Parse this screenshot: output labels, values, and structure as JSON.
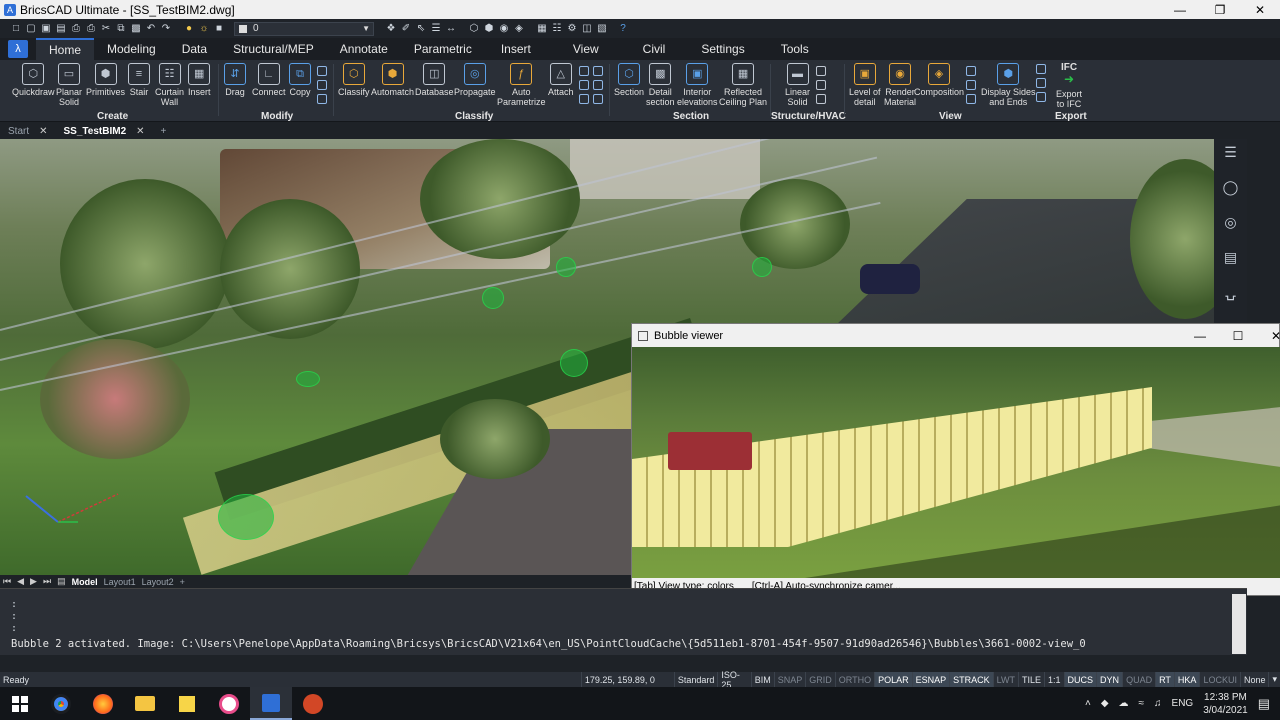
{
  "window": {
    "title": "BricsCAD Ultimate - [SS_TestBIM2.dwg]",
    "app_icon": "A"
  },
  "qat": {
    "layer_value": "0"
  },
  "ribbon_tabs": [
    "Home",
    "Modeling",
    "Data",
    "Structural/MEP",
    "Annotate",
    "Parametric",
    "Insert",
    "View",
    "Civil",
    "Settings",
    "Tools"
  ],
  "ribbon": {
    "buttons": [
      {
        "label": "Quickdraw",
        "icon": "quickdraw-icon"
      },
      {
        "label": "Planar\nSolid",
        "icon": "planar-solid-icon"
      },
      {
        "label": "Primitives",
        "icon": "primitives-icon"
      },
      {
        "label": "Stair",
        "icon": "stair-icon"
      },
      {
        "label": "Curtain\nWall",
        "icon": "curtain-wall-icon"
      },
      {
        "label": "Insert",
        "icon": "insert-icon"
      },
      {
        "label": "Drag",
        "icon": "drag-icon"
      },
      {
        "label": "Connect",
        "icon": "connect-icon"
      },
      {
        "label": "Copy",
        "icon": "copy-icon"
      },
      {
        "label": "Classify",
        "icon": "classify-icon"
      },
      {
        "label": "Automatch",
        "icon": "automatch-icon"
      },
      {
        "label": "Database",
        "icon": "database-icon"
      },
      {
        "label": "Propagate",
        "icon": "propagate-icon"
      },
      {
        "label": "Auto\nParametrize",
        "icon": "auto-parametrize-icon"
      },
      {
        "label": "Attach",
        "icon": "attach-icon"
      },
      {
        "label": "Section",
        "icon": "section-icon"
      },
      {
        "label": "Detail\nsection",
        "icon": "detail-section-icon"
      },
      {
        "label": "Interior\nelevations",
        "icon": "interior-elevations-icon"
      },
      {
        "label": "Reflected\nCeiling Plan",
        "icon": "reflected-ceiling-icon"
      },
      {
        "label": "Linear\nSolid",
        "icon": "linear-solid-icon"
      },
      {
        "label": "Level of\ndetail",
        "icon": "level-of-detail-icon"
      },
      {
        "label": "Render\nMaterial",
        "icon": "render-material-icon"
      },
      {
        "label": "Composition",
        "icon": "composition-icon"
      },
      {
        "label": "Display Sides\nand Ends",
        "icon": "display-sides-icon"
      },
      {
        "label": "Export\nto IFC",
        "icon": "export-ifc-icon"
      }
    ],
    "groups": [
      "Create",
      "Modify",
      "Classify",
      "Section",
      "Structure/HVAC",
      "View",
      "Export"
    ],
    "ifc_text": "IFC"
  },
  "doc_tabs": [
    {
      "label": "Start"
    },
    {
      "label": "SS_TestBIM2"
    }
  ],
  "doc_tab_add": "+",
  "bubble_viewer": {
    "title": "Bubble viewer",
    "status_left": "[Tab] View type: colors",
    "status_right": "[Ctrl-A] Auto-synchronize camer..."
  },
  "layout_tabs": [
    "Model",
    "Layout1",
    "Layout2"
  ],
  "layout_add": "+",
  "command": {
    "prompt_dots": [
      ":",
      ":",
      ":"
    ],
    "message": "Bubble 2 activated. Image: C:\\Users\\Penelope\\AppData\\Roaming\\Bricsys\\BricsCAD\\V21x64\\en_US\\PointCloudCache\\{5d511eb1-8701-454f-9507-91d90ad26546}\\Bubbles\\3661-0002-view_0"
  },
  "status": {
    "ready": "Ready",
    "coords": "179.25, 159.89, 0",
    "items": [
      {
        "label": "Standard",
        "state": "on"
      },
      {
        "label": "ISO-25",
        "state": "on"
      },
      {
        "label": "BIM",
        "state": "on"
      },
      {
        "label": "SNAP",
        "state": "off"
      },
      {
        "label": "GRID",
        "state": "off"
      },
      {
        "label": "ORTHO",
        "state": "off"
      },
      {
        "label": "POLAR",
        "state": "on"
      },
      {
        "label": "ESNAP",
        "state": "on"
      },
      {
        "label": "STRACK",
        "state": "on"
      },
      {
        "label": "LWT",
        "state": "off"
      },
      {
        "label": "TILE",
        "state": "on"
      },
      {
        "label": "1:1",
        "state": "on"
      },
      {
        "label": "DUCS",
        "state": "on"
      },
      {
        "label": "DYN",
        "state": "on"
      },
      {
        "label": "QUAD",
        "state": "off"
      },
      {
        "label": "RT",
        "state": "on"
      },
      {
        "label": "HKA",
        "state": "on"
      },
      {
        "label": "LOCKUI",
        "state": "off"
      },
      {
        "label": "None",
        "state": "on"
      }
    ]
  },
  "taskbar": {
    "apps": [
      "windows-start-icon",
      "chrome-icon",
      "firefox-icon",
      "file-explorer-icon",
      "sticky-notes-icon",
      "itunes-icon",
      "bricscad-icon",
      "powerpoint-icon"
    ],
    "language": "ENG",
    "time": "12:38 PM",
    "date": "3/04/2021"
  },
  "colors": {
    "accent": "#2f6fd6",
    "bubble": "#22b440"
  }
}
